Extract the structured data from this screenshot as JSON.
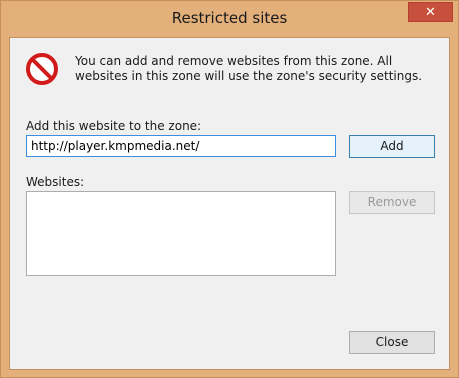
{
  "window": {
    "title": "Restricted sites",
    "close_glyph": "✕"
  },
  "info": {
    "icon": "restricted-icon",
    "text": "You can add and remove websites from this zone. All websites in this zone will use the zone's security settings."
  },
  "add": {
    "label": "Add this website to the zone:",
    "input_value": "http://player.kmpmedia.net/",
    "button_label": "Add"
  },
  "websites": {
    "label": "Websites:",
    "items": [],
    "remove_label": "Remove"
  },
  "footer": {
    "close_label": "Close"
  },
  "colors": {
    "frame": "#e3b07c",
    "close_button": "#c7503d",
    "focus_border": "#3d8ee0"
  }
}
